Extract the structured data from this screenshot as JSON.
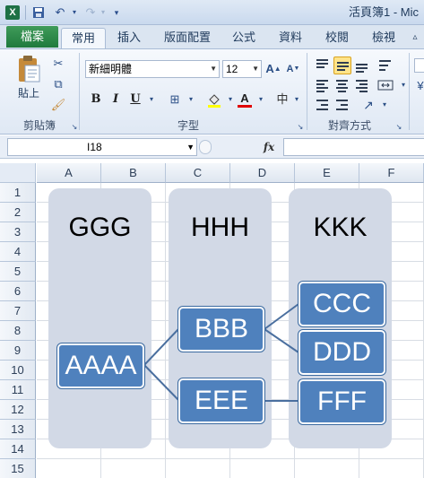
{
  "window": {
    "title": "活頁簿1 - Mic"
  },
  "tabs": {
    "file": "檔案",
    "items": [
      {
        "label": "常用"
      },
      {
        "label": "插入"
      },
      {
        "label": "版面配置"
      },
      {
        "label": "公式"
      },
      {
        "label": "資料"
      },
      {
        "label": "校閱"
      },
      {
        "label": "檢視"
      }
    ],
    "active": "常用"
  },
  "ribbon": {
    "clipboard": {
      "paste_label": "貼上",
      "group_label": "剪貼簿"
    },
    "font": {
      "font_name": "新細明體",
      "font_size": "12",
      "group_label": "字型",
      "bold": "B",
      "italic": "I",
      "underline": "U"
    },
    "alignment": {
      "group_label": "對齊方式"
    }
  },
  "formula_bar": {
    "name_box": "I18",
    "fx": "fx",
    "formula": ""
  },
  "columns": [
    "A",
    "B",
    "C",
    "D",
    "E",
    "F"
  ],
  "rows": [
    "1",
    "2",
    "3",
    "4",
    "5",
    "6",
    "7",
    "8",
    "9",
    "10",
    "11",
    "12",
    "13",
    "14",
    "15"
  ],
  "smartart": {
    "column_titles": [
      "GGG",
      "HHH",
      "KKK"
    ],
    "nodes": {
      "aaaa": "AAAA",
      "bbb": "BBB",
      "eee": "EEE",
      "ccc": "CCC",
      "ddd": "DDD",
      "fff": "FFF"
    }
  },
  "colors": {
    "file_tab": "#1f7a3d",
    "node_fill": "#4f81bd",
    "panel_fill": "#d2d9e6",
    "selected_align": "#ffe48a"
  }
}
